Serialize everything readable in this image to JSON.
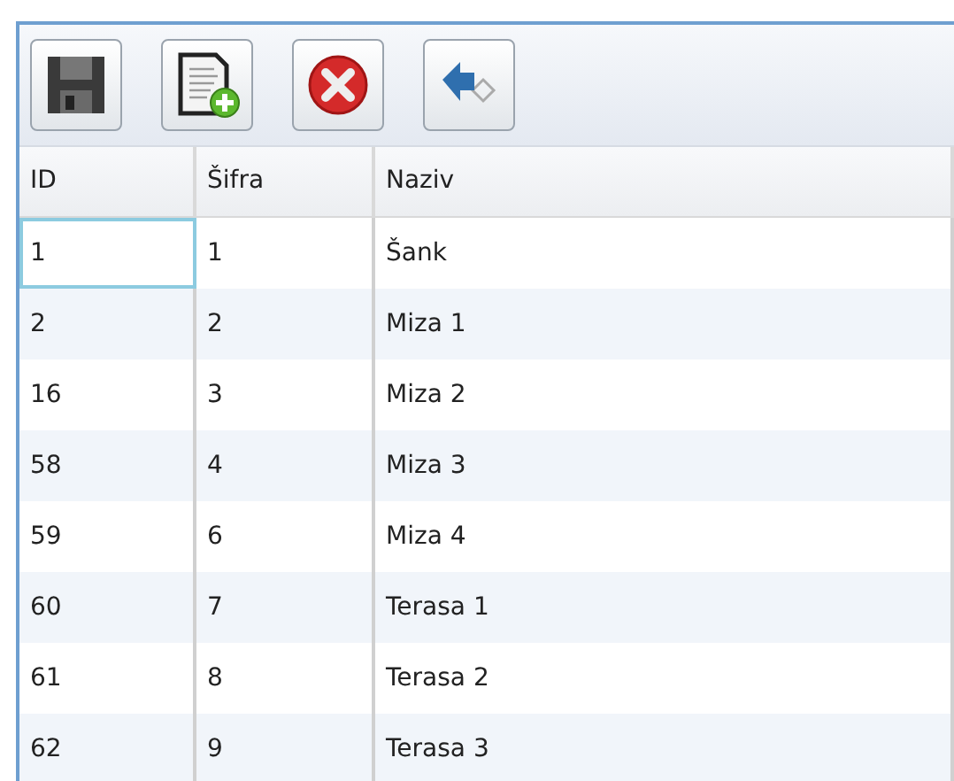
{
  "toolbar": {
    "buttons": [
      {
        "kind": "save"
      },
      {
        "kind": "new"
      },
      {
        "kind": "delete"
      },
      {
        "kind": "back"
      }
    ]
  },
  "table": {
    "columns": [
      "ID",
      "Šifra",
      "Naziv"
    ],
    "rows": [
      {
        "cells": [
          "1",
          "1",
          "Šank"
        ],
        "selected": true
      },
      {
        "cells": [
          "2",
          "2",
          "Miza 1"
        ],
        "selected": false
      },
      {
        "cells": [
          "16",
          "3",
          "Miza 2"
        ],
        "selected": false
      },
      {
        "cells": [
          "58",
          "4",
          "Miza 3"
        ],
        "selected": false
      },
      {
        "cells": [
          "59",
          "6",
          "Miza 4"
        ],
        "selected": false
      },
      {
        "cells": [
          "60",
          "7",
          "Terasa 1"
        ],
        "selected": false
      },
      {
        "cells": [
          "61",
          "8",
          "Terasa 2"
        ],
        "selected": false
      },
      {
        "cells": [
          "62",
          "9",
          "Terasa 3"
        ],
        "selected": false
      }
    ]
  }
}
